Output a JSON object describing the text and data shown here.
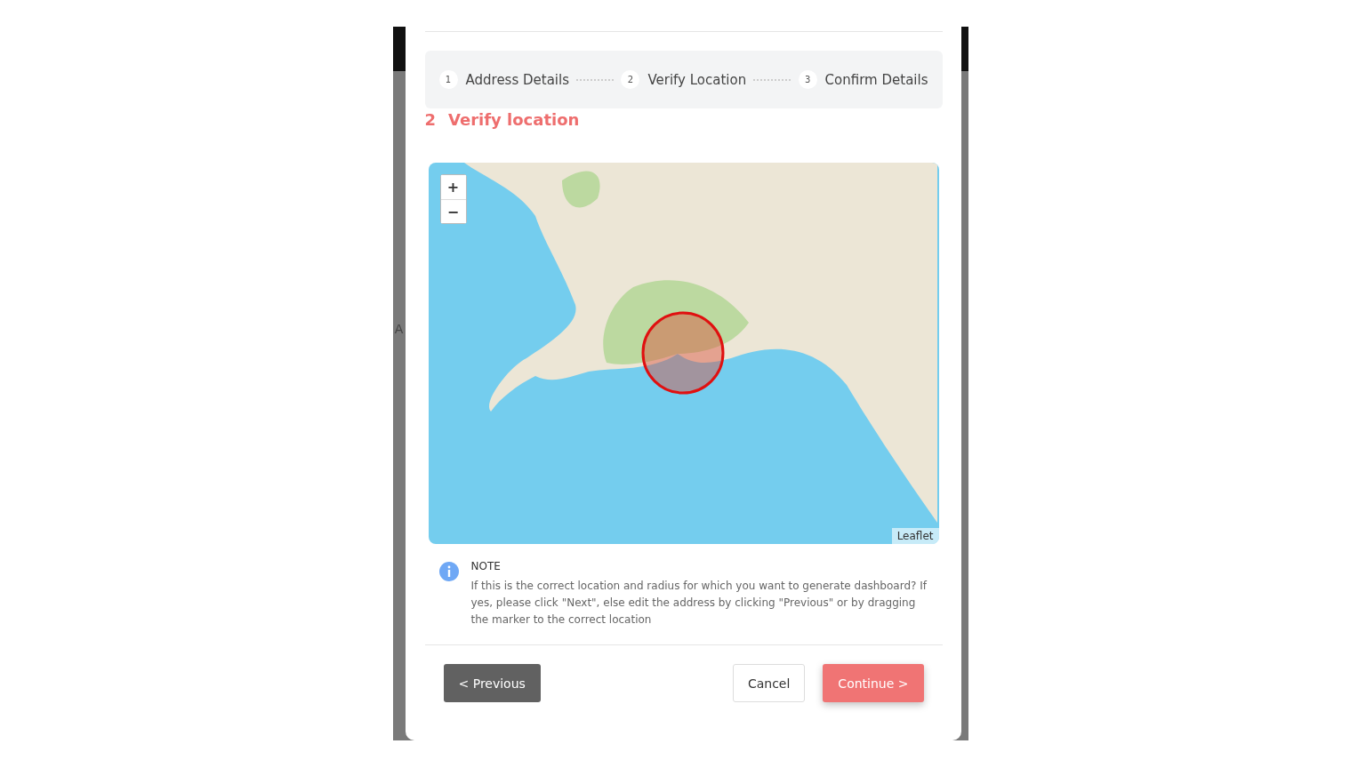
{
  "backdrop": {
    "text": "A"
  },
  "steps": [
    {
      "number": "1",
      "label": "Address Details"
    },
    {
      "number": "2",
      "label": "Verify Location"
    },
    {
      "number": "3",
      "label": "Confirm Details"
    }
  ],
  "section": {
    "number": "2",
    "title": "Verify location"
  },
  "map": {
    "zoom_in": "+",
    "zoom_out": "−",
    "attribution": "Leaflet"
  },
  "note": {
    "title": "NOTE",
    "text": "If this is the correct location and radius for which you want to generate dashboard? If yes, please click \"Next\", else edit the address by clicking \"Previous\" or by dragging the marker to the correct location"
  },
  "buttons": [
    {
      "kind": "secondary",
      "label": "< Previous"
    },
    {
      "kind": "plain",
      "label": "Cancel"
    },
    {
      "kind": "primary",
      "label": "Continue >"
    }
  ]
}
